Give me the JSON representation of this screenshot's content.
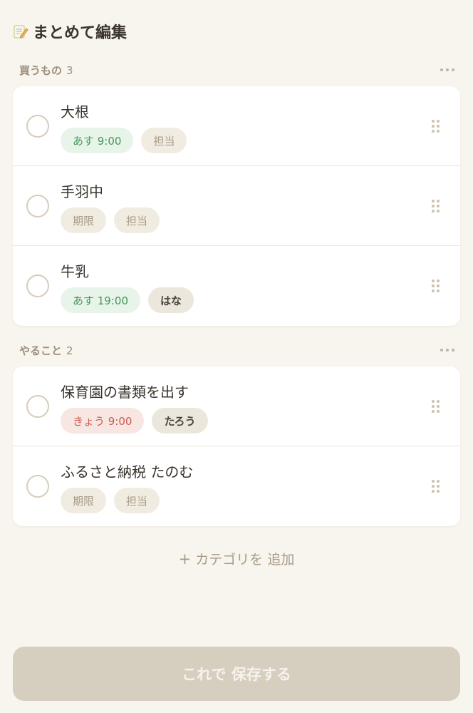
{
  "header": {
    "title": "まとめて編集",
    "icon": "memo-icon"
  },
  "sections": [
    {
      "name": "買うもの",
      "count": "3",
      "tasks": [
        {
          "title": "大根",
          "chips": [
            {
              "label": "あす 9:00",
              "tone": "green"
            },
            {
              "label": "担当",
              "tone": "muted"
            }
          ]
        },
        {
          "title": "手羽中",
          "chips": [
            {
              "label": "期限",
              "tone": "muted"
            },
            {
              "label": "担当",
              "tone": "muted"
            }
          ]
        },
        {
          "title": "牛乳",
          "chips": [
            {
              "label": "あす 19:00",
              "tone": "green"
            },
            {
              "label": "はな",
              "tone": "person"
            }
          ]
        }
      ]
    },
    {
      "name": "やること",
      "count": "2",
      "tasks": [
        {
          "title": "保育園の書類を出す",
          "chips": [
            {
              "label": "きょう 9:00",
              "tone": "red"
            },
            {
              "label": "たろう",
              "tone": "person"
            }
          ]
        },
        {
          "title": "ふるさと納税 たのむ",
          "chips": [
            {
              "label": "期限",
              "tone": "muted"
            },
            {
              "label": "担当",
              "tone": "muted"
            }
          ]
        }
      ]
    }
  ],
  "add_category": {
    "plus": "+",
    "label": "カテゴリを 追加"
  },
  "save_button": {
    "label": "これで 保存する"
  },
  "colors": {
    "background": "#f8f5ee",
    "due_tomorrow": "#3f9a55",
    "due_today": "#cc5a4c",
    "muted": "#a89b86",
    "save_button_bg": "#d6cfc0"
  }
}
